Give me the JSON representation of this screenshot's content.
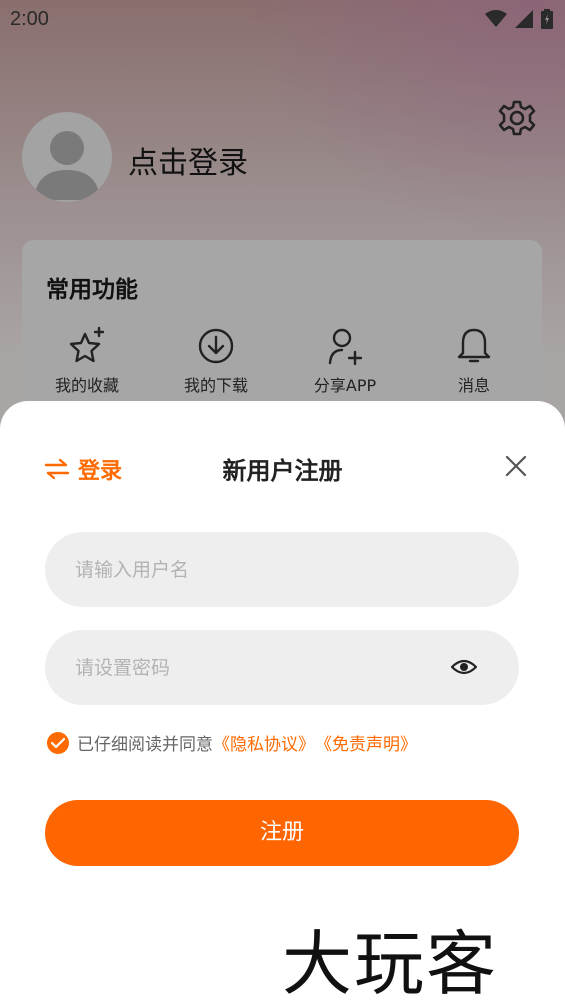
{
  "status_bar": {
    "time": "2:00"
  },
  "profile": {
    "login_prompt": "点击登录"
  },
  "functions": {
    "title": "常用功能",
    "items": [
      {
        "label": "我的收藏",
        "icon": "star-sparkle-icon"
      },
      {
        "label": "我的下载",
        "icon": "download-icon"
      },
      {
        "label": "分享APP",
        "icon": "add-user-icon"
      },
      {
        "label": "消息",
        "icon": "bell-icon"
      }
    ]
  },
  "sheet": {
    "switch_label": "登录",
    "title": "新用户注册",
    "username_placeholder": "请输入用户名",
    "password_placeholder": "请设置密码",
    "agree_text": "已仔细阅读并同意",
    "privacy_link": "《隐私协议》",
    "disclaimer_link": "《免责声明》",
    "register_label": "注册"
  },
  "watermark": "大玩客",
  "colors": {
    "accent": "#ff6500",
    "field_bg": "#eeeeee"
  }
}
